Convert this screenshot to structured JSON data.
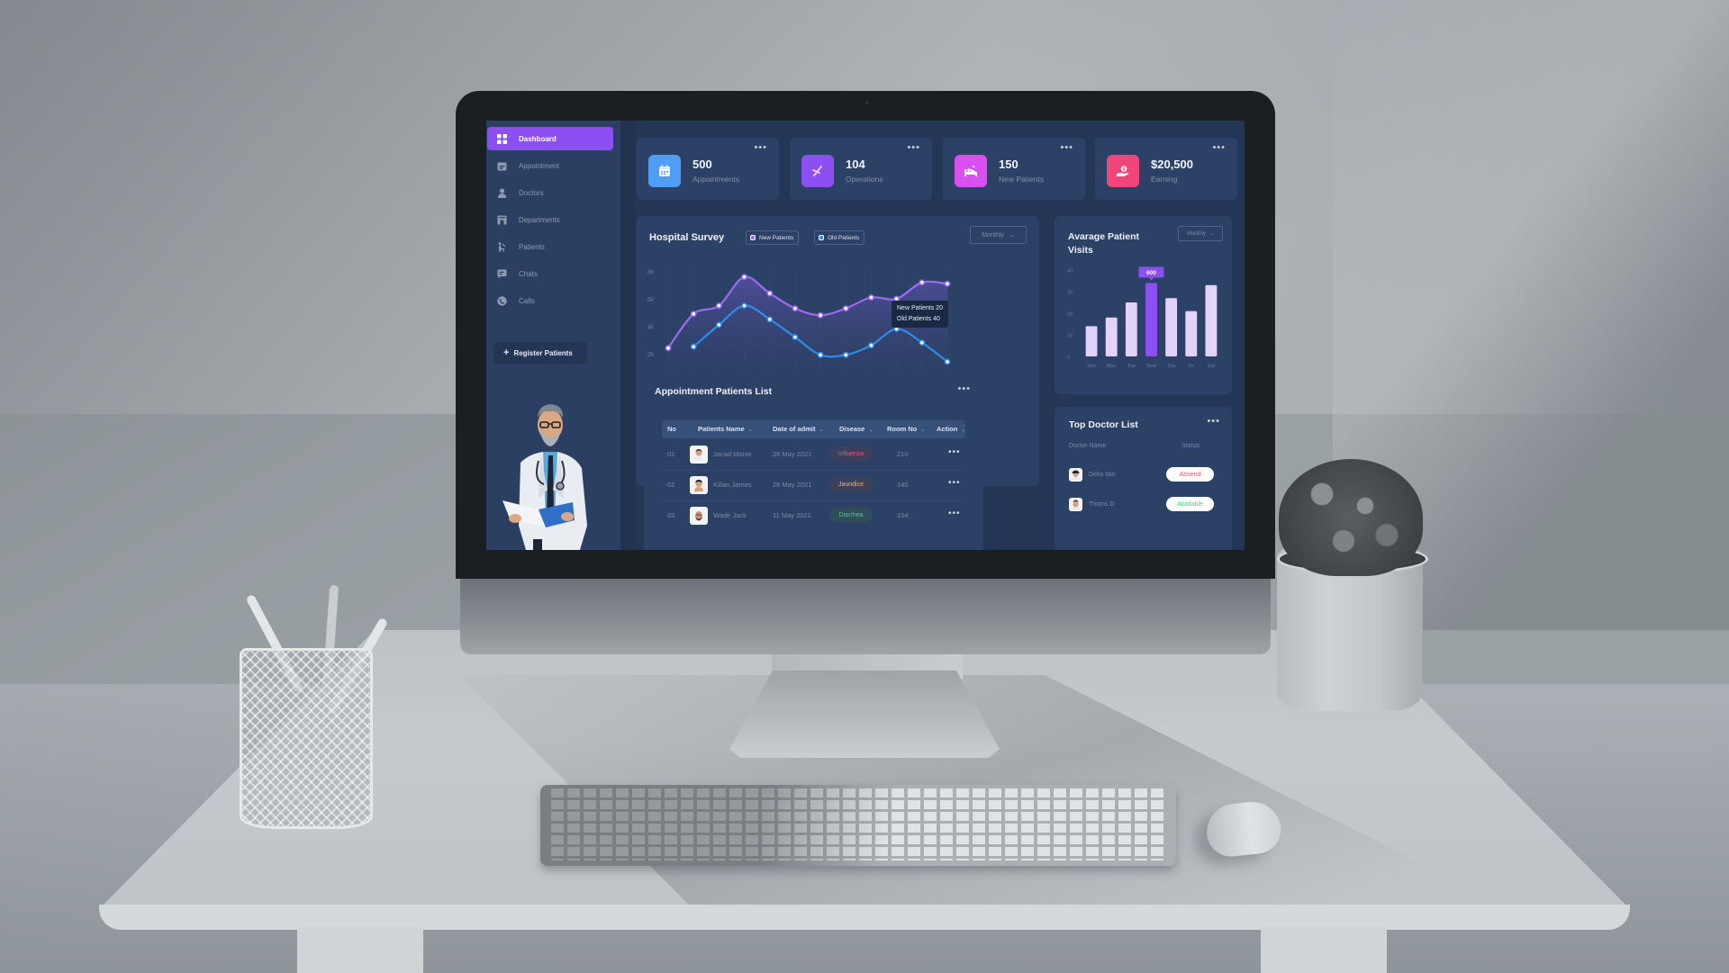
{
  "sidebar": {
    "items": [
      {
        "label": "Dashboard",
        "icon": "grid-icon",
        "active": true
      },
      {
        "label": "Appointment",
        "icon": "calendar-icon",
        "active": false
      },
      {
        "label": "Doctors",
        "icon": "doctor-icon",
        "active": false
      },
      {
        "label": "Departments",
        "icon": "building-icon",
        "active": false
      },
      {
        "label": "Patients",
        "icon": "patient-icon",
        "active": false
      },
      {
        "label": "Chats",
        "icon": "chat-icon",
        "active": false
      },
      {
        "label": "Calls",
        "icon": "phone-icon",
        "active": false
      }
    ],
    "register_button": {
      "icon": "plus-icon",
      "label": "Register Patients"
    }
  },
  "stats": [
    {
      "value": "500",
      "label": "Appointments",
      "icon": "calendar-icon",
      "color": "#4f9df5"
    },
    {
      "value": "104",
      "label": "Operations",
      "icon": "scissors-icon",
      "color": "#8b4ff2"
    },
    {
      "value": "150",
      "label": "New Patients",
      "icon": "hospital-bed-icon",
      "color": "#d94ff0"
    },
    {
      "value": "$20,500",
      "label": "Earning",
      "icon": "money-hand-icon",
      "color": "#f0457b"
    }
  ],
  "more_label": "•••",
  "survey": {
    "title": "Hospital Survey",
    "legend": [
      {
        "label": "New Patients",
        "color": "#9b6cf2"
      },
      {
        "label": "Old Patients",
        "color": "#2f8ce8"
      }
    ],
    "dropdown": "Monthly",
    "tooltip": {
      "line1": "New Patients 20",
      "line2": "Old Patients 40"
    }
  },
  "visits": {
    "title_line1": "Avarage Patient",
    "title_line2": "Visits",
    "dropdown": "Monthly",
    "highlight_label": "600"
  },
  "appointments": {
    "title": "Appointment Patients List",
    "columns": [
      "No",
      "Patients Name",
      "Date of admit",
      "Disease",
      "Room No",
      "Action"
    ],
    "rows": [
      {
        "no": "01",
        "name": "Jacad Monie",
        "date": "28 May 2021",
        "disease": "Influenza",
        "disease_color": "#f0566e",
        "disease_bg": "#3d3f5e",
        "room": "210"
      },
      {
        "no": "02",
        "name": "Killan James",
        "date": "28 May 2021",
        "disease": "Jaundice",
        "disease_color": "#f0b26b",
        "disease_bg": "#3b4258",
        "room": "140"
      },
      {
        "no": "03",
        "name": "Wade Jack",
        "date": "11 May 2021",
        "disease": "Diarrhea",
        "disease_color": "#4ccf72",
        "disease_bg": "#2f4d5b",
        "room": "154"
      }
    ]
  },
  "doctors": {
    "title": "Top Doctor List",
    "col_name": "Doctor Name",
    "col_status": "Status",
    "rows": [
      {
        "name": "Deko Ilan",
        "status": "Absend",
        "status_color": "#f0566e"
      },
      {
        "name": "Thoms D",
        "status": "Abailable",
        "status_color": "#4ccf72"
      }
    ]
  },
  "chart_data": [
    {
      "type": "line",
      "title": "Hospital Survey",
      "xlabel": "",
      "ylabel": "",
      "y_ticks": [
        "8k",
        "6k",
        "4k",
        "2k"
      ],
      "ylim": [
        1000,
        8500
      ],
      "grid": false,
      "legend": "top-left",
      "series": [
        {
          "name": "New Patients",
          "color": "#9b6cf2",
          "values": [
            2400,
            4900,
            5500,
            7600,
            6400,
            5300,
            4800,
            5300,
            6100,
            6000,
            7200,
            7100
          ]
        },
        {
          "name": "Old Patients",
          "color": "#2f8ce8",
          "values": [
            null,
            2500,
            4100,
            5500,
            4500,
            3200,
            1900,
            1900,
            2600,
            3800,
            2800,
            1400
          ]
        }
      ],
      "tooltip": {
        "index": 8,
        "text": [
          "New Patients 20",
          "Old Patients 40"
        ]
      }
    },
    {
      "type": "bar",
      "title": "Avarage Patient Visits",
      "categories": [
        "Sun",
        "Mon",
        "Tue",
        "Wed",
        "Thu",
        "Fri",
        "Sat"
      ],
      "values": [
        14,
        18,
        25,
        34,
        27,
        21,
        33
      ],
      "highlight_index": 3,
      "highlight_label": "600",
      "y_ticks": [
        "40",
        "30",
        "20",
        "10",
        "0"
      ],
      "ylim": [
        0,
        40
      ],
      "colors": {
        "default": "#e3d3fb",
        "highlight": "#8b4ff2"
      }
    }
  ]
}
